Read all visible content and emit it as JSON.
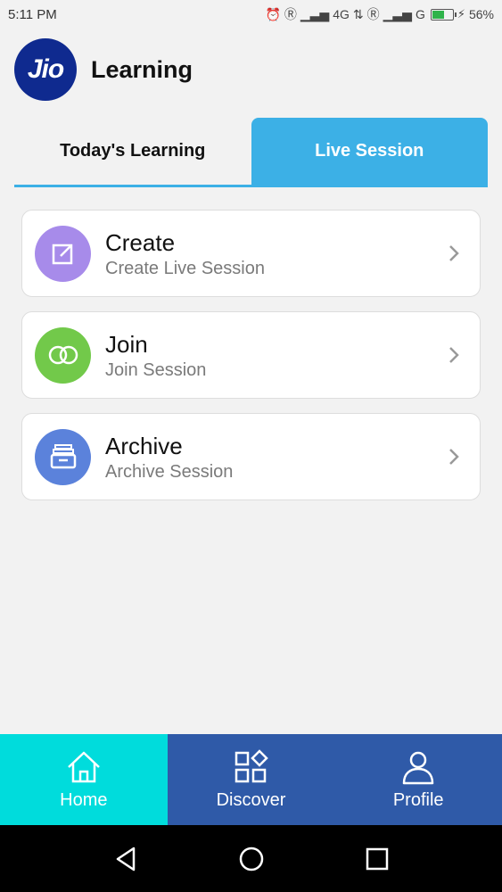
{
  "status_bar": {
    "time": "5:11 PM",
    "network_1": "4G",
    "network_2": "G",
    "battery": "56%"
  },
  "header": {
    "logo_text": "Jio",
    "title": "Learning"
  },
  "tabs": [
    {
      "label": "Today's Learning",
      "active": false
    },
    {
      "label": "Live Session",
      "active": true
    }
  ],
  "cards": [
    {
      "title": "Create",
      "subtitle": "Create Live Session",
      "icon": "edit-icon",
      "color": "#a78bea"
    },
    {
      "title": "Join",
      "subtitle": "Join Session",
      "icon": "link-rings-icon",
      "color": "#72c94a"
    },
    {
      "title": "Archive",
      "subtitle": "Archive Session",
      "icon": "archive-box-icon",
      "color": "#5b82db"
    }
  ],
  "bottom_nav": [
    {
      "label": "Home",
      "icon": "home-icon",
      "active": true
    },
    {
      "label": "Discover",
      "icon": "grid-icon",
      "active": false
    },
    {
      "label": "Profile",
      "icon": "user-icon",
      "active": false
    }
  ],
  "colors": {
    "accent": "#3cb0e6",
    "nav_bg": "#2f5aa8",
    "nav_active": "#00dcdc",
    "logo_bg": "#0f2a8f"
  }
}
